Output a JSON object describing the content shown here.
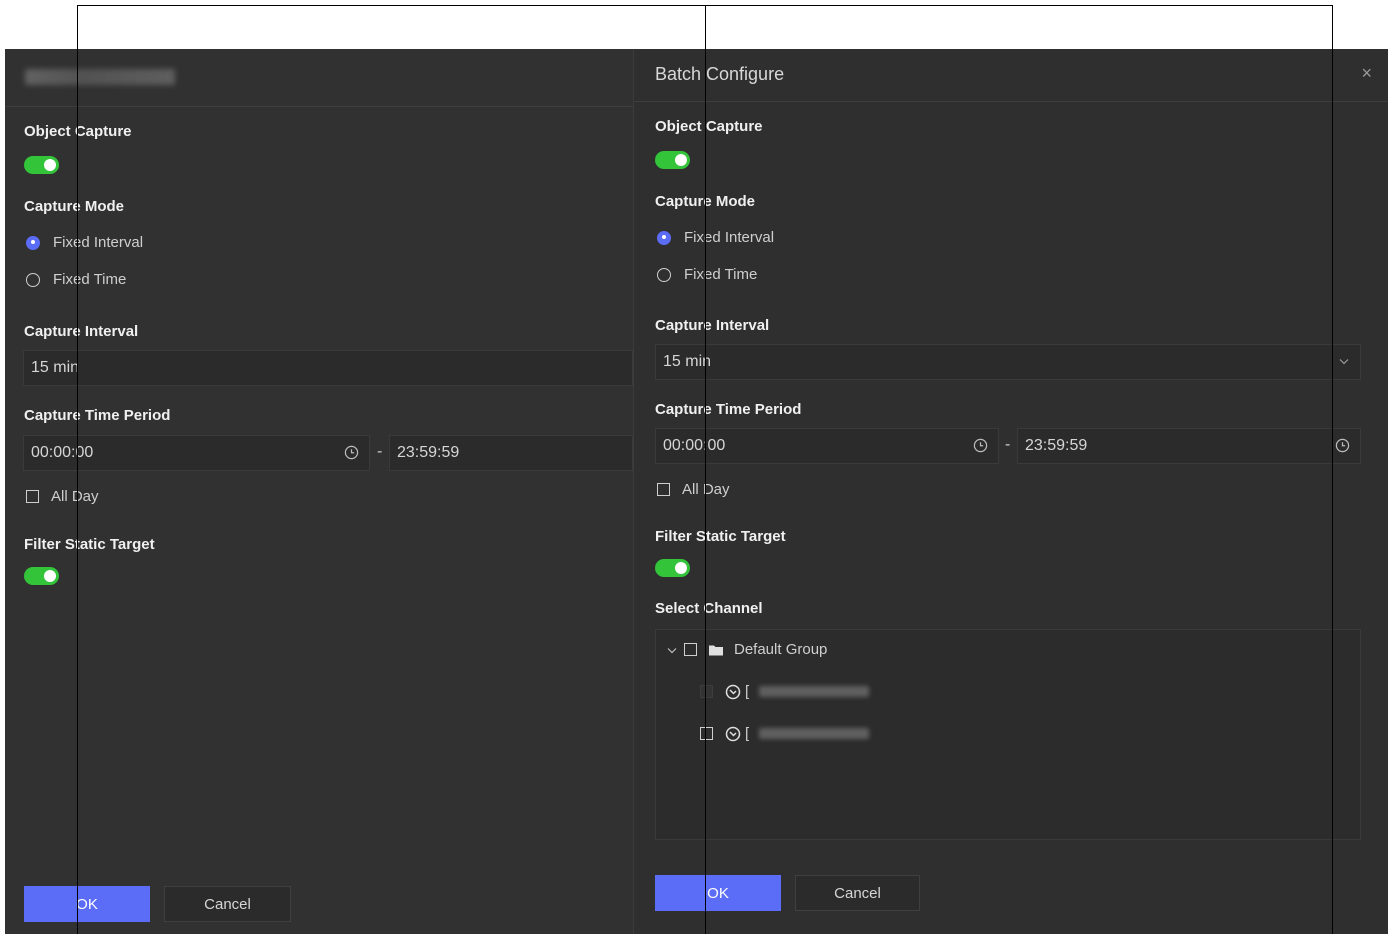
{
  "left_panel": {
    "object_capture_label": "Object Capture",
    "capture_mode_label": "Capture Mode",
    "mode_fixed_interval": "Fixed Interval",
    "mode_fixed_time": "Fixed Time",
    "capture_interval_label": "Capture Interval",
    "capture_interval_value": "15 min",
    "capture_time_period_label": "Capture Time Period",
    "start_time": "00:00:00",
    "end_time": "23:59:59",
    "dash": "-",
    "all_day_label": "All Day",
    "filter_static_label": "Filter Static Target",
    "ok_label": "OK",
    "cancel_label": "Cancel"
  },
  "right_panel": {
    "title": "Batch Configure",
    "close_icon": "×",
    "object_capture_label": "Object Capture",
    "capture_mode_label": "Capture Mode",
    "mode_fixed_interval": "Fixed Interval",
    "mode_fixed_time": "Fixed Time",
    "capture_interval_label": "Capture Interval",
    "capture_interval_value": "15 min",
    "capture_time_period_label": "Capture Time Period",
    "start_time": "00:00:00",
    "end_time": "23:59:59",
    "dash": "-",
    "all_day_label": "All Day",
    "filter_static_label": "Filter Static Target",
    "select_channel_label": "Select Channel",
    "group_name": "Default Group",
    "camera_bracket": "[",
    "ok_label": "OK",
    "cancel_label": "Cancel"
  },
  "colors": {
    "accent": "#5b6cf6",
    "toggle_on": "#33c43a",
    "panel_bg": "#313131"
  },
  "icons": [
    "close-icon",
    "clock-icon",
    "chevron-down-icon",
    "folder-icon",
    "camera-icon"
  ]
}
